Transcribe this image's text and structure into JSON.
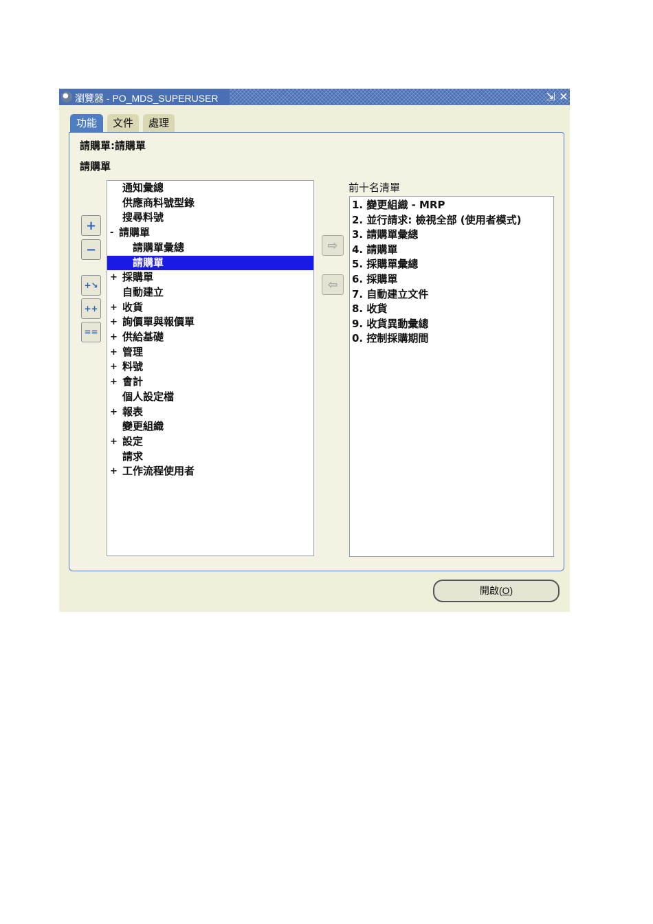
{
  "window": {
    "title": "瀏覽器 - PO_MDS_SUPERUSER",
    "minimize_symbol": "⇲",
    "close_symbol": "✕",
    "accent_color": "#4f7dc1"
  },
  "tabs": [
    {
      "label": "功能",
      "active": true
    },
    {
      "label": "文件",
      "active": false
    },
    {
      "label": "處理",
      "active": false
    }
  ],
  "breadcrumb": {
    "path": "請購單:請購單",
    "current": "請購單"
  },
  "side_buttons": [
    {
      "icon": "expand-plus-icon",
      "glyph": "+"
    },
    {
      "icon": "collapse-minus-icon",
      "glyph": "−"
    },
    {
      "icon": "expand-branch-icon",
      "glyph": "+↘"
    },
    {
      "icon": "expand-all-icon",
      "glyph": "++"
    },
    {
      "icon": "collapse-all-icon",
      "glyph": "=="
    }
  ],
  "tree": [
    {
      "toggle": "",
      "label": "通知彙總",
      "level": 1
    },
    {
      "toggle": "",
      "label": "供應商料號型錄",
      "level": 1
    },
    {
      "toggle": "",
      "label": "搜尋料號",
      "level": 1
    },
    {
      "toggle": "-",
      "label": "請購單",
      "level": 1
    },
    {
      "toggle": "",
      "label": "請購單彙總",
      "level": 2
    },
    {
      "toggle": "",
      "label": "請購單",
      "level": 2,
      "selected": true
    },
    {
      "toggle": "+",
      "label": "採購單",
      "level": 1
    },
    {
      "toggle": "",
      "label": "自動建立",
      "level": 1
    },
    {
      "toggle": "+",
      "label": "收貨",
      "level": 1
    },
    {
      "toggle": "+",
      "label": "詢價單與報價單",
      "level": 1
    },
    {
      "toggle": "+",
      "label": "供給基礎",
      "level": 1
    },
    {
      "toggle": "+",
      "label": "管理",
      "level": 1
    },
    {
      "toggle": "+",
      "label": "料號",
      "level": 1
    },
    {
      "toggle": "+",
      "label": "會計",
      "level": 1
    },
    {
      "toggle": "",
      "label": "個人設定檔",
      "level": 1
    },
    {
      "toggle": "+",
      "label": "報表",
      "level": 1
    },
    {
      "toggle": "",
      "label": "變更組織",
      "level": 1
    },
    {
      "toggle": "+",
      "label": "設定",
      "level": 1
    },
    {
      "toggle": "",
      "label": "請求",
      "level": 1
    },
    {
      "toggle": "+",
      "label": "工作流程使用者",
      "level": 1
    }
  ],
  "transfer": {
    "add_glyph": "⇨",
    "remove_glyph": "⇦"
  },
  "top10": {
    "label": "前十名清單",
    "items": [
      "1. 變更組織 - MRP",
      "2. 並行請求: 檢視全部 (使用者模式)",
      "3. 請購單彙總",
      "4. 請購單",
      "5. 採購單彙總",
      "6. 採購單",
      "7. 自動建立文件",
      "8. 收貨",
      "9. 收貨異動彙總",
      "0. 控制採購期間"
    ]
  },
  "open_button": {
    "label": "開啟",
    "mnemonic_prefix": "(",
    "mnemonic": "O",
    "mnemonic_suffix": ")"
  }
}
